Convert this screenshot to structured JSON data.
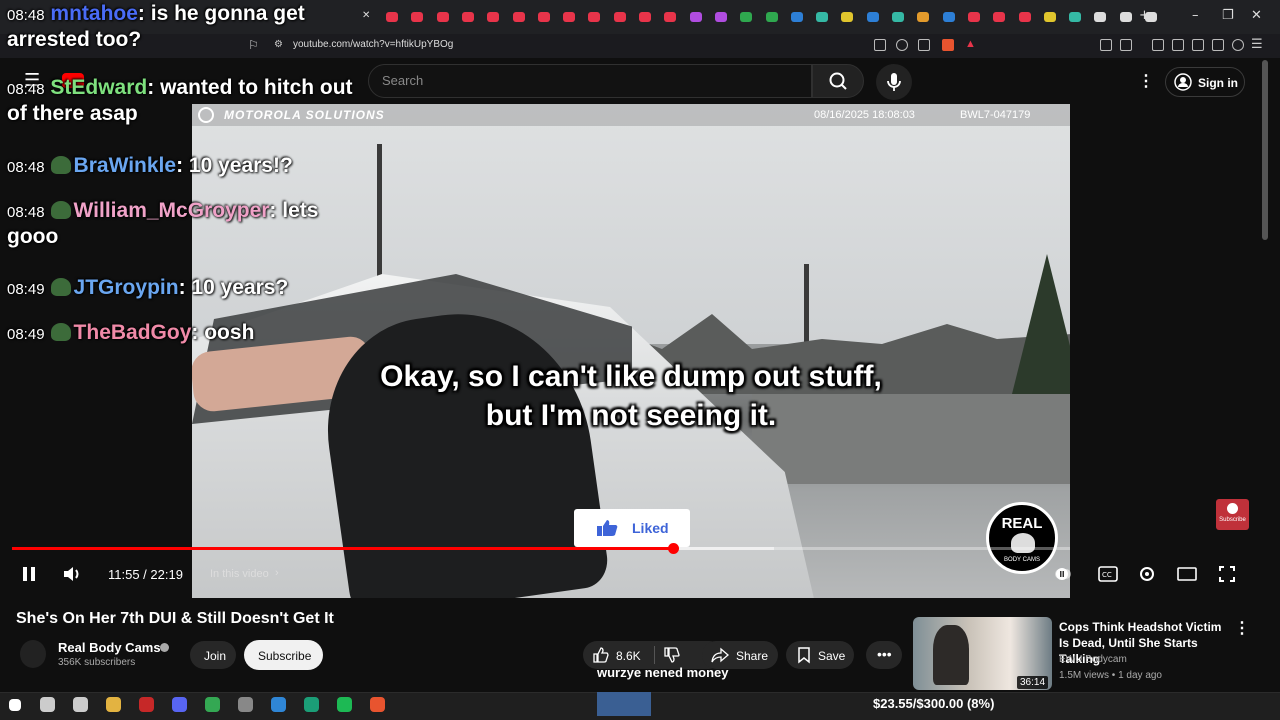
{
  "browser": {
    "url": "youtube.com/watch?v=hftikUpYBOg",
    "tab_colors": [
      "#e8344a",
      "#e8344a",
      "#e8344a",
      "#e8344a",
      "#e8344a",
      "#e8344a",
      "#e8344a",
      "#e8344a",
      "#e8344a",
      "#e8344a",
      "#e8344a",
      "#e8344a",
      "#b04de0",
      "#b04de0",
      "#2fa84f",
      "#2fa84f",
      "#2d7fd6",
      "#35b9a5",
      "#e0c52d",
      "#2d7fd6",
      "#35b9a5",
      "#e39b2c",
      "#2d7fd6",
      "#e8344a",
      "#e8344a",
      "#e8344a",
      "#e0c52d",
      "#35b9a5",
      "#dddddd",
      "#dddddd",
      "#dddddd"
    ]
  },
  "youtube": {
    "search_placeholder": "Search",
    "sign_in": "Sign in"
  },
  "video": {
    "overlay_brand": "MOTOROLA SOLUTIONS",
    "timestamp": "08/16/2025 18:08:03",
    "device_id": "BWL7-047179",
    "subtitle_line1": "Okay, so I can't like dump out stuff,",
    "subtitle_line2": "but I'm not seeing it.",
    "liked_label": "Liked",
    "logo_text": "REAL",
    "logo_sub": "BODY CAMS",
    "time_display": "11:55 / 22:19",
    "in_this_video": "In this video",
    "progress_fraction": 0.625,
    "buffer_fraction": 0.72,
    "progress_color": "#ff0000"
  },
  "chat": [
    {
      "time": "08:48",
      "user": "mntahoe",
      "color": "#4a6cf7",
      "message": "is he gonna get arrested too?",
      "line1": "is he gonna get",
      "line2": "arrested too?"
    },
    {
      "time": "08:48",
      "user": "StEdward",
      "color": "#7ee07e",
      "message": "wanted to hitch out of there asap",
      "line1": "wanted to hitch out",
      "line2": "of there asap"
    },
    {
      "time": "08:48",
      "user": "BraWinkle",
      "color": "#6aa6f0",
      "message": "10 years!?"
    },
    {
      "time": "08:48",
      "user": "William_McGroyper",
      "color": "#f0a2c8",
      "message": "lets gooo",
      "line1": "lets",
      "line2": "gooo"
    },
    {
      "time": "08:49",
      "user": "JTGroypin",
      "color": "#6aa6f0",
      "message": "10 years?"
    },
    {
      "time": "08:49",
      "user": "TheBadGoy",
      "color": "#f08aa8",
      "message": "oosh"
    }
  ],
  "details": {
    "title": "She's On Her 7th DUI & Still Doesn't Get It",
    "channel": "Real Body Cams",
    "subscribers": "356K subscribers",
    "join": "Join",
    "subscribe": "Subscribe",
    "likes": "8.6K",
    "share": "Share",
    "save": "Save",
    "overlay_text": "wurzye nened money"
  },
  "recommendation": {
    "title": "Cops Think Headshot Victim Is Dead, Until She Starts Talking",
    "channel": "EWU Bodycam",
    "meta": "1.5M views • 1 day ago",
    "duration": "36:14"
  },
  "subscribe_float": "Subscribe",
  "taskbar": {
    "goal": "$23.55/$300.00 (8%)",
    "icon_colors": [
      "#3d8bfd",
      "#cccccc",
      "#cccccc",
      "#e3b341",
      "#c62828",
      "#5865f2",
      "#34a853",
      "#888888",
      "#2f86d6",
      "#1b9e77",
      "#1db954",
      "#e8542f"
    ]
  }
}
